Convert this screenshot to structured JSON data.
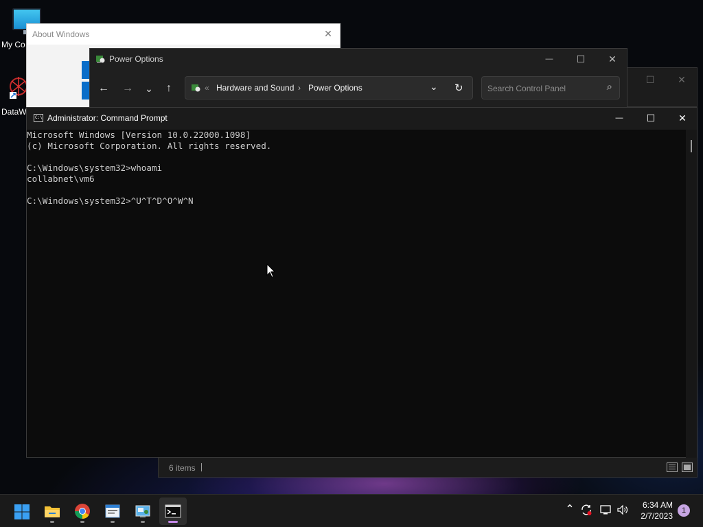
{
  "desktop": {
    "icons": [
      {
        "label": "My Co"
      },
      {
        "label": "DataW"
      }
    ]
  },
  "about_window": {
    "title": "About Windows",
    "close": "✕"
  },
  "power_options": {
    "title": "Power Options",
    "minimize": "—",
    "maximize": "☐",
    "close": "✕",
    "nav": {
      "back": "←",
      "forward": "→",
      "recent": "⌄",
      "up": "↑"
    },
    "address": {
      "overflow": "«",
      "crumbs": [
        "Hardware and Sound",
        "Power Options"
      ],
      "separator": "›",
      "dropdown": "⌄",
      "refresh": "↻"
    },
    "search": {
      "placeholder": "Search Control Panel",
      "icon": "⌕"
    },
    "status": {
      "items": "6 items"
    },
    "tail_max": "☐",
    "tail_close": "✕"
  },
  "cmd": {
    "title": "Administrator: Command Prompt",
    "icon_text": "C:\\",
    "minimize": "—",
    "maximize": "☐",
    "close": "✕",
    "lines": [
      "Microsoft Windows [Version 10.0.22000.1098]",
      "(c) Microsoft Corporation. All rights reserved.",
      "",
      "C:\\Windows\\system32>whoami",
      "collabnet\\vm6",
      "",
      "C:\\Windows\\system32>^U^T^D^O^W^N"
    ]
  },
  "taskbar": {
    "apps": [
      "start",
      "file-explorer",
      "chrome",
      "notepad",
      "control-panel",
      "command-prompt"
    ],
    "active_app": "command-prompt",
    "tray": {
      "chevron": "⌃",
      "time": "6:34 AM",
      "date": "2/7/2023",
      "notification_count": "1"
    }
  },
  "colors": {
    "cmd_bg": "#0c0c0c",
    "cmd_text": "#cccccc",
    "accent": "#0a6ec9",
    "active_indicator": "#c489e8"
  }
}
